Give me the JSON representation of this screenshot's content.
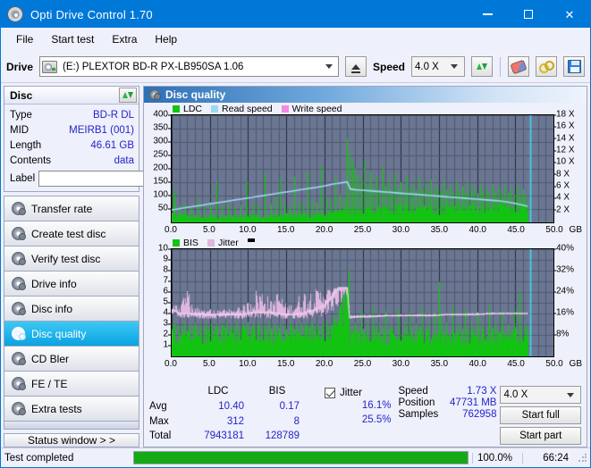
{
  "window": {
    "title": "Opti Drive Control 1.70",
    "icon": "disc-icon",
    "minimize_label": "–",
    "maximize_label": "☐",
    "close_label": "✕"
  },
  "menu": {
    "items": [
      {
        "label": "File"
      },
      {
        "label": "Start test"
      },
      {
        "label": "Extra"
      },
      {
        "label": "Help"
      }
    ]
  },
  "toolbar": {
    "drive_label": "Drive",
    "drive_value": "(E:)  PLEXTOR BD-R  PX-LB950SA 1.06",
    "eject_icon": "eject-icon",
    "speed_label": "Speed",
    "speed_value": "4.0 X",
    "refresh_icon": "refresh-icon",
    "eraser_icon": "eraser-icon",
    "tools_icon": "tools-icon",
    "save_icon": "save-icon"
  },
  "disc_panel": {
    "title": "Disc",
    "refresh_icon": "refresh-icon",
    "rows": [
      {
        "key": "Type",
        "value": "BD-R DL"
      },
      {
        "key": "MID",
        "value": "MEIRB1 (001)"
      },
      {
        "key": "Length",
        "value": "46.61 GB"
      },
      {
        "key": "Contents",
        "value": "data"
      }
    ],
    "label_key": "Label",
    "label_value": "",
    "label_placeholder": "",
    "disc_button_icon": "disc-icon"
  },
  "sidebar": {
    "items": [
      {
        "label": "Transfer rate",
        "icon": "disc-transfer-icon",
        "active": false
      },
      {
        "label": "Create test disc",
        "icon": "disc-create-icon",
        "active": false
      },
      {
        "label": "Verify test disc",
        "icon": "disc-verify-icon",
        "active": false
      },
      {
        "label": "Drive info",
        "icon": "disc-drive-icon",
        "active": false
      },
      {
        "label": "Disc info",
        "icon": "disc-info-icon",
        "active": false
      },
      {
        "label": "Disc quality",
        "icon": "disc-quality-icon",
        "active": true
      },
      {
        "label": "CD Bler",
        "icon": "disc-bler-icon",
        "active": false
      },
      {
        "label": "FE / TE",
        "icon": "disc-fete-icon",
        "active": false
      },
      {
        "label": "Extra tests",
        "icon": "disc-extra-icon",
        "active": false
      }
    ],
    "status_window": "Status window > >"
  },
  "main": {
    "header_title": "Disc quality",
    "header_icon": "disc-quality-icon"
  },
  "stats": {
    "col_headers": [
      "",
      "LDC",
      "BIS"
    ],
    "rows": [
      {
        "label": "Avg",
        "ldc": "10.40",
        "bis": "0.17"
      },
      {
        "label": "Max",
        "ldc": "312",
        "bis": "8"
      },
      {
        "label": "Total",
        "ldc": "7943181",
        "bis": "128789"
      }
    ],
    "jitter_label": "Jitter",
    "jitter_checked": true,
    "jitter_avg": "16.1%",
    "jitter_max": "25.5%",
    "speed_label": "Speed",
    "speed_value": "1.73 X",
    "position_label": "Position",
    "position_value": "47731 MB",
    "samples_label": "Samples",
    "samples_value": "762958",
    "speed_select_value": "4.0 X",
    "start_full_label": "Start full",
    "start_part_label": "Start part"
  },
  "statusbar": {
    "message": "Test completed",
    "progress_percent": "100.0%",
    "progress_value": 100,
    "elapsed": "66:24"
  },
  "colors": {
    "accent": "#0078d7",
    "ldc": "#13c413",
    "bis": "#13c413",
    "read_speed": "#9fd8f5",
    "write_speed": "#f58ae0",
    "jitter": "#e0b6e0",
    "plot_bg": "#6b7792",
    "grid": "#3b4458",
    "value_text": "#2424c8",
    "progress": "#15a915",
    "marker": "#3fd8f5"
  },
  "chart_data": [
    {
      "type": "line",
      "name": "disc-quality-ldc-chart",
      "title": "LDC / Read speed",
      "xlabel": "GB",
      "ylabel": "LDC",
      "xlim": [
        0,
        50
      ],
      "ylim": [
        0,
        400
      ],
      "xticks": [
        0.0,
        5.0,
        10.0,
        15.0,
        20.0,
        25.0,
        30.0,
        35.0,
        40.0,
        45.0,
        50.0
      ],
      "xticklabels": [
        "0.0",
        "5.0",
        "10.0",
        "15.0",
        "20.0",
        "25.0",
        "30.0",
        "35.0",
        "40.0",
        "45.0",
        "50.0"
      ],
      "x_unit": "GB",
      "yticks": [
        50,
        100,
        150,
        200,
        250,
        300,
        350,
        400
      ],
      "yticklabels": [
        "50",
        "100",
        "150",
        "200",
        "250",
        "300",
        "350",
        "400"
      ],
      "y2label": "Speed",
      "y2lim": [
        0,
        18
      ],
      "y2ticks": [
        2,
        4,
        6,
        8,
        10,
        12,
        14,
        16,
        18
      ],
      "y2ticklabels": [
        "2 X",
        "4 X",
        "6 X",
        "8 X",
        "10 X",
        "12 X",
        "14 X",
        "16 X",
        "18 X"
      ],
      "grid": true,
      "legend": [
        "LDC",
        "Read speed",
        "Write speed"
      ],
      "legend_position": "top-left",
      "data_end_gb": 46.61,
      "series": [
        {
          "name": "LDC",
          "kind": "impulse",
          "color": "#13c413",
          "baseline_x": [
            0,
            2,
            4,
            6,
            8,
            10,
            12,
            14,
            16,
            18,
            20,
            21,
            22,
            23,
            24,
            26,
            28,
            30,
            32,
            34,
            36,
            38,
            40,
            42,
            44,
            46,
            46.6
          ],
          "baseline_y": [
            28,
            22,
            20,
            20,
            20,
            22,
            22,
            24,
            26,
            28,
            30,
            32,
            34,
            48,
            42,
            44,
            46,
            46,
            48,
            50,
            50,
            52,
            54,
            56,
            58,
            60,
            60
          ],
          "spikes_x": [
            0.2,
            0.4,
            1.0,
            1.8,
            2.6,
            3.4,
            4.2,
            5.0,
            5.8,
            6.6,
            7.4,
            8.2,
            9.0,
            9.8,
            10.6,
            11.4,
            12.2,
            13.0,
            13.6,
            14.2,
            14.8,
            15.4,
            16.0,
            16.6,
            17.2,
            17.8,
            18.4,
            19.0,
            19.6,
            20.2,
            20.8,
            21.4,
            22.0,
            22.6,
            23.0,
            23.3,
            23.6,
            24.0,
            24.4,
            24.8,
            25.2,
            25.6,
            26.0,
            26.4,
            26.8,
            27.2,
            27.6,
            28.0,
            28.4,
            28.8,
            29.2,
            29.6,
            30.0,
            30.4,
            30.8,
            31.2,
            31.6,
            32.0,
            32.4,
            32.8,
            33.2,
            33.6,
            34.0,
            34.4,
            34.8,
            35.2,
            35.6,
            36.0,
            36.4,
            36.8,
            37.2,
            37.6,
            38.0,
            38.4,
            38.8,
            39.2,
            39.6,
            40.0,
            40.4,
            40.8,
            41.2,
            41.6,
            42.0,
            42.4,
            42.8,
            43.2,
            43.6,
            44.0,
            44.4,
            44.8,
            45.2,
            45.6,
            46.0,
            46.4
          ],
          "spikes_y": [
            120,
            95,
            60,
            70,
            55,
            88,
            62,
            75,
            150,
            62,
            70,
            58,
            64,
            150,
            72,
            66,
            180,
            70,
            95,
            165,
            74,
            62,
            170,
            80,
            68,
            190,
            86,
            74,
            210,
            96,
            88,
            165,
            104,
            92,
            312,
            260,
            230,
            200,
            175,
            150,
            230,
            140,
            190,
            130,
            170,
            125,
            205,
            135,
            160,
            120,
            185,
            128,
            150,
            118,
            175,
            126,
            145,
            118,
            168,
            124,
            142,
            116,
            160,
            122,
            138,
            114,
            155,
            120,
            136,
            112,
            150,
            118,
            134,
            110,
            148,
            116,
            132,
            108,
            145,
            114,
            130,
            106,
            142,
            112,
            128,
            104,
            140,
            110,
            126,
            102,
            138,
            108,
            124,
            100
          ]
        },
        {
          "name": "Read speed",
          "kind": "line",
          "color": "#9fd8f5",
          "x": [
            0,
            1,
            2,
            3,
            4,
            5,
            6,
            7,
            8,
            9,
            10,
            11,
            12,
            13,
            14,
            15,
            16,
            17,
            18,
            19,
            20,
            21,
            22,
            23,
            23.4,
            24,
            25,
            26,
            27,
            28,
            29,
            30,
            31,
            32,
            33,
            34,
            35,
            36,
            37,
            38,
            39,
            40,
            41,
            42,
            43,
            44,
            45,
            46,
            46.6
          ],
          "y": [
            2.1,
            2.3,
            2.5,
            2.7,
            2.9,
            3.1,
            3.3,
            3.5,
            3.7,
            3.9,
            4.1,
            4.3,
            4.5,
            4.7,
            4.9,
            5.1,
            5.3,
            5.5,
            5.7,
            5.9,
            6.1,
            6.4,
            6.6,
            6.8,
            5.6,
            5.5,
            5.4,
            5.3,
            5.2,
            5.1,
            5.0,
            4.9,
            4.8,
            4.7,
            4.6,
            4.5,
            4.4,
            4.3,
            4.2,
            4.1,
            4.0,
            3.9,
            3.8,
            3.7,
            3.6,
            3.4,
            3.2,
            2.9,
            2.7
          ]
        },
        {
          "name": "Write speed",
          "kind": "none",
          "color": "#f58ae0",
          "x": [],
          "y": []
        }
      ],
      "markers": [
        {
          "name": "position-marker",
          "x": 46.9,
          "color": "#3fd8f5"
        }
      ]
    },
    {
      "type": "line",
      "name": "disc-quality-bis-chart",
      "title": "BIS / Jitter",
      "xlabel": "GB",
      "ylabel": "BIS",
      "xlim": [
        0,
        50
      ],
      "ylim": [
        0,
        10
      ],
      "xticks": [
        0.0,
        5.0,
        10.0,
        15.0,
        20.0,
        25.0,
        30.0,
        35.0,
        40.0,
        45.0,
        50.0
      ],
      "xticklabels": [
        "0.0",
        "5.0",
        "10.0",
        "15.0",
        "20.0",
        "25.0",
        "30.0",
        "35.0",
        "40.0",
        "45.0",
        "50.0"
      ],
      "x_unit": "GB",
      "yticks": [
        1,
        2,
        3,
        4,
        5,
        6,
        7,
        8,
        9,
        10
      ],
      "yticklabels": [
        "1",
        "2",
        "3",
        "4",
        "5",
        "6",
        "7",
        "8",
        "9",
        "10"
      ],
      "y2label": "Jitter",
      "y2lim": [
        0,
        40
      ],
      "y2ticks": [
        8,
        16,
        24,
        32,
        40
      ],
      "y2ticklabels": [
        "8%",
        "16%",
        "24%",
        "32%",
        "40%"
      ],
      "grid": true,
      "legend": [
        "BIS",
        "Jitter"
      ],
      "legend_position": "top-left",
      "data_end_gb": 46.61,
      "series": [
        {
          "name": "BIS",
          "kind": "impulse",
          "color": "#13c413",
          "baseline_x": [
            0,
            5,
            10,
            15,
            20,
            21,
            22,
            23,
            23.3,
            25,
            30,
            35,
            40,
            45,
            46.6
          ],
          "baseline_y": [
            2.1,
            2.1,
            2.1,
            2.1,
            2.2,
            2.6,
            3.4,
            5.6,
            1.9,
            1.9,
            1.9,
            1.9,
            1.9,
            1.9,
            1.9
          ],
          "spikes_x": [
            0.3,
            0.9,
            1.6,
            2.3,
            3.0,
            3.7,
            4.4,
            5.1,
            5.8,
            6.5,
            7.2,
            7.9,
            8.6,
            9.3,
            10.0,
            10.7,
            11.4,
            12.1,
            12.8,
            13.5,
            14.2,
            14.9,
            15.6,
            16.3,
            17.0,
            17.7,
            18.4,
            19.1,
            19.8,
            20.5,
            21.2,
            21.9,
            22.6,
            23.2,
            24.0,
            24.8,
            25.6,
            26.4,
            27.2,
            28.0,
            28.8,
            29.6,
            30.4,
            31.2,
            32.0,
            32.8,
            33.6,
            34.4,
            35.0,
            35.2,
            36.0,
            36.8,
            37.6,
            38.4,
            39.2,
            40.0,
            40.8,
            41.6,
            42.4,
            43.2,
            44.0,
            44.8,
            45.6,
            46.2
          ],
          "spikes_y": [
            3.1,
            2.9,
            3.2,
            3.0,
            3.1,
            2.9,
            3.2,
            3.0,
            3.1,
            2.9,
            3.2,
            3.0,
            3.1,
            2.9,
            3.2,
            3.0,
            3.1,
            2.9,
            3.2,
            3.0,
            3.1,
            2.9,
            3.2,
            3.0,
            3.1,
            2.9,
            3.2,
            3.0,
            3.1,
            2.9,
            3.2,
            3.0,
            6.2,
            8.0,
            3.1,
            4.3,
            3.0,
            4.6,
            3.1,
            4.2,
            3.0,
            4.4,
            3.1,
            4.1,
            3.0,
            4.5,
            3.1,
            4.2,
            6.9,
            4.0,
            3.1,
            4.6,
            3.0,
            4.3,
            3.1,
            4.1,
            3.0,
            4.7,
            3.1,
            4.2,
            3.0,
            4.4,
            6.1,
            3.0
          ]
        },
        {
          "name": "Jitter",
          "kind": "band",
          "color": "#e0b6e0",
          "x": [
            0,
            1,
            2,
            3,
            4,
            5,
            6,
            7,
            8,
            9,
            10,
            11,
            12,
            13,
            14,
            15,
            16,
            17,
            18,
            19,
            20,
            21,
            21.8,
            22.6,
            23.0,
            23.3,
            24,
            26,
            28,
            30,
            32,
            34,
            36,
            38,
            40,
            42,
            44,
            46,
            46.6
          ],
          "y": [
            4.4,
            4.0,
            4.0,
            3.9,
            3.9,
            3.9,
            3.9,
            3.9,
            3.9,
            3.9,
            4.0,
            4.1,
            4.1,
            4.1,
            4.0,
            3.9,
            3.9,
            4.0,
            4.2,
            4.4,
            4.8,
            5.6,
            6.4,
            6.4,
            6.4,
            3.6,
            3.7,
            3.7,
            3.8,
            3.8,
            3.8,
            3.8,
            3.9,
            3.9,
            3.9,
            4.0,
            4.0,
            4.0,
            4.0
          ],
          "y_low": [
            3.7,
            3.6,
            3.6,
            3.5,
            3.5,
            3.5,
            3.5,
            3.5,
            3.5,
            3.5,
            3.5,
            3.5,
            3.5,
            3.5,
            3.5,
            3.5,
            3.5,
            3.5,
            3.5,
            3.6,
            3.7,
            4.0,
            4.6,
            5.4,
            6.0,
            3.5,
            3.6,
            3.6,
            3.7,
            3.7,
            3.7,
            3.7,
            3.8,
            3.8,
            3.8,
            3.9,
            3.9,
            3.9,
            3.9
          ],
          "y_high": [
            5.0,
            4.6,
            6.3,
            4.6,
            4.5,
            4.4,
            4.4,
            4.4,
            4.5,
            4.6,
            5.2,
            6.3,
            6.3,
            5.2,
            6.3,
            4.8,
            5.0,
            6.2,
            6.3,
            6.3,
            6.4,
            6.4,
            6.4,
            6.4,
            6.4,
            3.8,
            3.9,
            3.9,
            3.9,
            3.9,
            4.0,
            4.0,
            4.0,
            4.0,
            4.1,
            4.1,
            4.1,
            4.1,
            4.1
          ]
        }
      ],
      "markers": [
        {
          "name": "position-marker",
          "x": 46.9,
          "color": "#3fd8f5"
        }
      ]
    }
  ]
}
